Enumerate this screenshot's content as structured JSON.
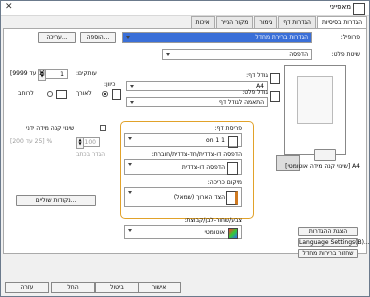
{
  "window": {
    "title": "מאפייני"
  },
  "tabs": [
    "הגדרות בסיסיות",
    "הגדרות דף",
    "גימור",
    "מקור הנייר",
    "איכות"
  ],
  "profile": {
    "label": "פרופיל:",
    "value": "הגדרות ברירת מחדל",
    "add_label": "הוספה...",
    "edit_label": "עריכה..."
  },
  "output_method": {
    "label": "שיטת פלט:",
    "value": "הדפסה"
  },
  "paper_size": {
    "label": "גודל דף:",
    "value": "A4"
  },
  "output_paper_size": {
    "label": "גודל פלט:",
    "value": "התאמה לגודל דף"
  },
  "copies": {
    "label": "עותקים:",
    "value": "1",
    "range": "[1 עד 9999]"
  },
  "orientation": {
    "label": "כיוון:",
    "portrait": "לאורך",
    "landscape": "לרוחב"
  },
  "page_layout": {
    "label": "פריסת דף:",
    "value": "1 on 1"
  },
  "duplex": {
    "label": "הדפסה דו-צדדית/חד-צדדית/חוברת:",
    "value": "הדפסה דו-צדדית"
  },
  "binding": {
    "label": "מיקום כריכה:",
    "value": "הצד הארוך (שמאל)"
  },
  "manual_scaling": {
    "label": "שינוי קנה מידה ידני",
    "value": "100",
    "unit": "% [25 עד 200]"
  },
  "fit_long_edge": {
    "label": "הגדר בכתב"
  },
  "margin_button": {
    "label": "נקודות שוליים..."
  },
  "color_mode": {
    "label": "צבע/שחור-לבן/קבוצת:",
    "value": "אוטומטי"
  },
  "preview": {
    "caption": "A4 [שינוי קנה מידה אוטומטי]"
  },
  "side_buttons": {
    "show_settings": "הצגת ההגדרות",
    "language": "Language Settings(B)...",
    "defaults": "שחזור ברירות מחדל"
  },
  "footer": {
    "ok": "אישור",
    "cancel": "ביטול",
    "apply": "החל",
    "help": "עזרה"
  }
}
